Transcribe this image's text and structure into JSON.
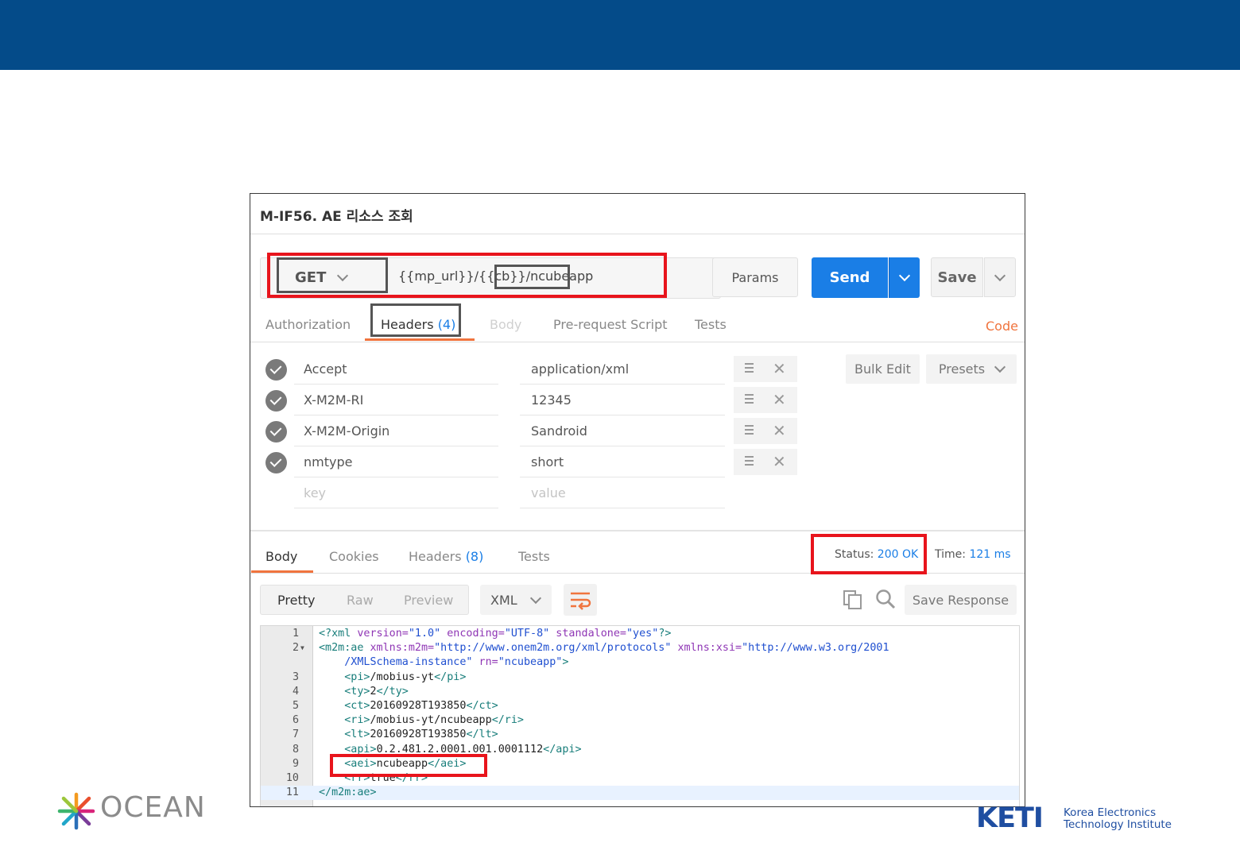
{
  "request": {
    "title": "M-IF56. AE 리소스 조회",
    "method": "GET",
    "url_prefix": "{{mp_url}}/{{cb}}",
    "url_suffix": "/ncubeapp",
    "params_label": "Params",
    "send_label": "Send",
    "save_label": "Save"
  },
  "request_tabs": [
    {
      "label": "Authorization"
    },
    {
      "label": "Headers",
      "count": "(4)"
    },
    {
      "label": "Body"
    },
    {
      "label": "Pre-request Script"
    },
    {
      "label": "Tests"
    }
  ],
  "code_label": "Code",
  "headers": [
    {
      "key": "Accept",
      "value": "application/xml"
    },
    {
      "key": "X-M2M-RI",
      "value": "12345"
    },
    {
      "key": "X-M2M-Origin",
      "value": "Sandroid"
    },
    {
      "key": "nmtype",
      "value": "short"
    }
  ],
  "new_header": {
    "key_placeholder": "key",
    "value_placeholder": "value"
  },
  "bulk_edit_label": "Bulk Edit",
  "presets_label": "Presets",
  "response_tabs": [
    {
      "label": "Body"
    },
    {
      "label": "Cookies"
    },
    {
      "label": "Headers",
      "count": "(8)"
    },
    {
      "label": "Tests"
    }
  ],
  "status": {
    "label": "Status:",
    "value": "200 OK"
  },
  "time": {
    "label": "Time:",
    "value": "121 ms"
  },
  "view_modes": [
    "Pretty",
    "Raw",
    "Preview"
  ],
  "format": "XML",
  "save_response_label": "Save Response",
  "code_lines": [
    {
      "n": "1",
      "parts": [
        [
          "tg",
          "<?xml "
        ],
        [
          "at",
          "version="
        ],
        [
          "sv",
          "\"1.0\""
        ],
        [
          "at",
          " encoding="
        ],
        [
          "sv",
          "\"UTF-8\""
        ],
        [
          "at",
          " standalone="
        ],
        [
          "sv",
          "\"yes\""
        ],
        [
          "tg",
          "?>"
        ]
      ]
    },
    {
      "n": "2",
      "fold": true,
      "parts": [
        [
          "tg",
          "<m2m:ae "
        ],
        [
          "at",
          "xmlns:m2m="
        ],
        [
          "sv",
          "\"http://www.onem2m.org/xml/protocols\""
        ],
        [
          "at",
          " xmlns:xsi="
        ],
        [
          "sv",
          "\"http://www.w3.org/2001"
        ]
      ]
    },
    {
      "n": "",
      "parts": [
        [
          "sv",
          "    /XMLSchema-instance\""
        ],
        [
          "at",
          " rn="
        ],
        [
          "sv",
          "\"ncubeapp\""
        ],
        [
          "tg",
          ">"
        ]
      ]
    },
    {
      "n": "3",
      "parts": [
        [
          "tg",
          "    <pi>"
        ],
        [
          "tx",
          "/mobius-yt"
        ],
        [
          "tg",
          "</pi>"
        ]
      ]
    },
    {
      "n": "4",
      "parts": [
        [
          "tg",
          "    <ty>"
        ],
        [
          "tx",
          "2"
        ],
        [
          "tg",
          "</ty>"
        ]
      ]
    },
    {
      "n": "5",
      "parts": [
        [
          "tg",
          "    <ct>"
        ],
        [
          "tx",
          "20160928T193850"
        ],
        [
          "tg",
          "</ct>"
        ]
      ]
    },
    {
      "n": "6",
      "parts": [
        [
          "tg",
          "    <ri>"
        ],
        [
          "tx",
          "/mobius-yt/ncubeapp"
        ],
        [
          "tg",
          "</ri>"
        ]
      ]
    },
    {
      "n": "7",
      "parts": [
        [
          "tg",
          "    <lt>"
        ],
        [
          "tx",
          "20160928T193850"
        ],
        [
          "tg",
          "</lt>"
        ]
      ]
    },
    {
      "n": "8",
      "parts": [
        [
          "tg",
          "    <api>"
        ],
        [
          "tx",
          "0.2.481.2.0001.001.0001112"
        ],
        [
          "tg",
          "</api>"
        ]
      ]
    },
    {
      "n": "9",
      "parts": [
        [
          "tg",
          "    <aei>"
        ],
        [
          "tx",
          "ncubeapp"
        ],
        [
          "tg",
          "</aei>"
        ]
      ]
    },
    {
      "n": "10",
      "parts": [
        [
          "tg",
          "    <rr>"
        ],
        [
          "tx",
          "true"
        ],
        [
          "tg",
          "</rr>"
        ]
      ]
    },
    {
      "n": "11",
      "highlight": true,
      "parts": [
        [
          "tg",
          "</m2m:ae>"
        ]
      ]
    }
  ],
  "logos": {
    "ocean": "OCEAN",
    "keti_mark": "KETI",
    "keti_line1": "Korea Electronics",
    "keti_line2": "Technology Institute"
  },
  "colors": {
    "header_bar": "#044b89",
    "send": "#1a7ee6",
    "accent": "#f0743e",
    "highlight_red": "#e8141c",
    "keti_blue": "#1f4ea1"
  }
}
